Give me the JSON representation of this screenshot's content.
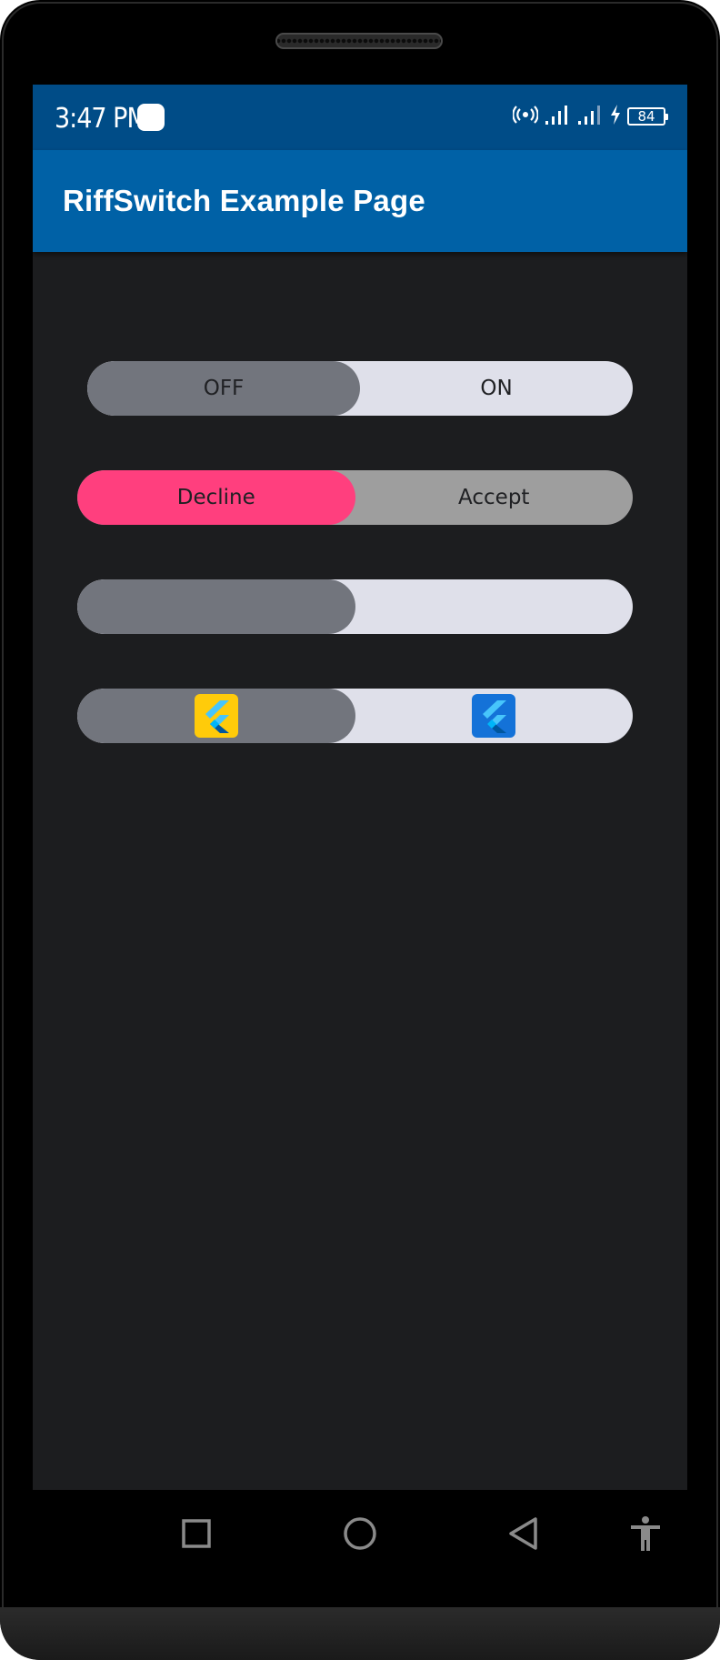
{
  "status_bar": {
    "time": "3:47 PM",
    "battery_level": "84",
    "icons": [
      "notification-app-icon",
      "hotspot-icon",
      "signal-icon",
      "signal-icon",
      "charging-icon",
      "battery-icon"
    ]
  },
  "app_bar": {
    "title": "RiffSwitch Example Page"
  },
  "switches": [
    {
      "left_label": "OFF",
      "right_label": "ON",
      "selected": "left"
    },
    {
      "left_label": "Decline",
      "right_label": "Accept",
      "selected": "left"
    },
    {
      "left_label": "",
      "right_label": "",
      "selected": "left"
    },
    {
      "left_icon": "flutter-logo-icon",
      "right_icon": "flutter-logo-icon",
      "selected": "left"
    }
  ],
  "nav_bar": {
    "icons": [
      "recents-icon",
      "home-icon",
      "back-icon",
      "accessibility-icon"
    ]
  },
  "colors": {
    "status_bar": "#004c87",
    "app_bar": "#0061a6",
    "screen_background": "#1c1d1f",
    "switch_track": "#dfe0ea",
    "switch_thumb": "#72757d",
    "decline_thumb": "#ff3f7e",
    "accept_track": "#9e9e9e",
    "flutter_tile_left": "#ffcb0a",
    "flutter_tile_right": "#1472d8"
  }
}
